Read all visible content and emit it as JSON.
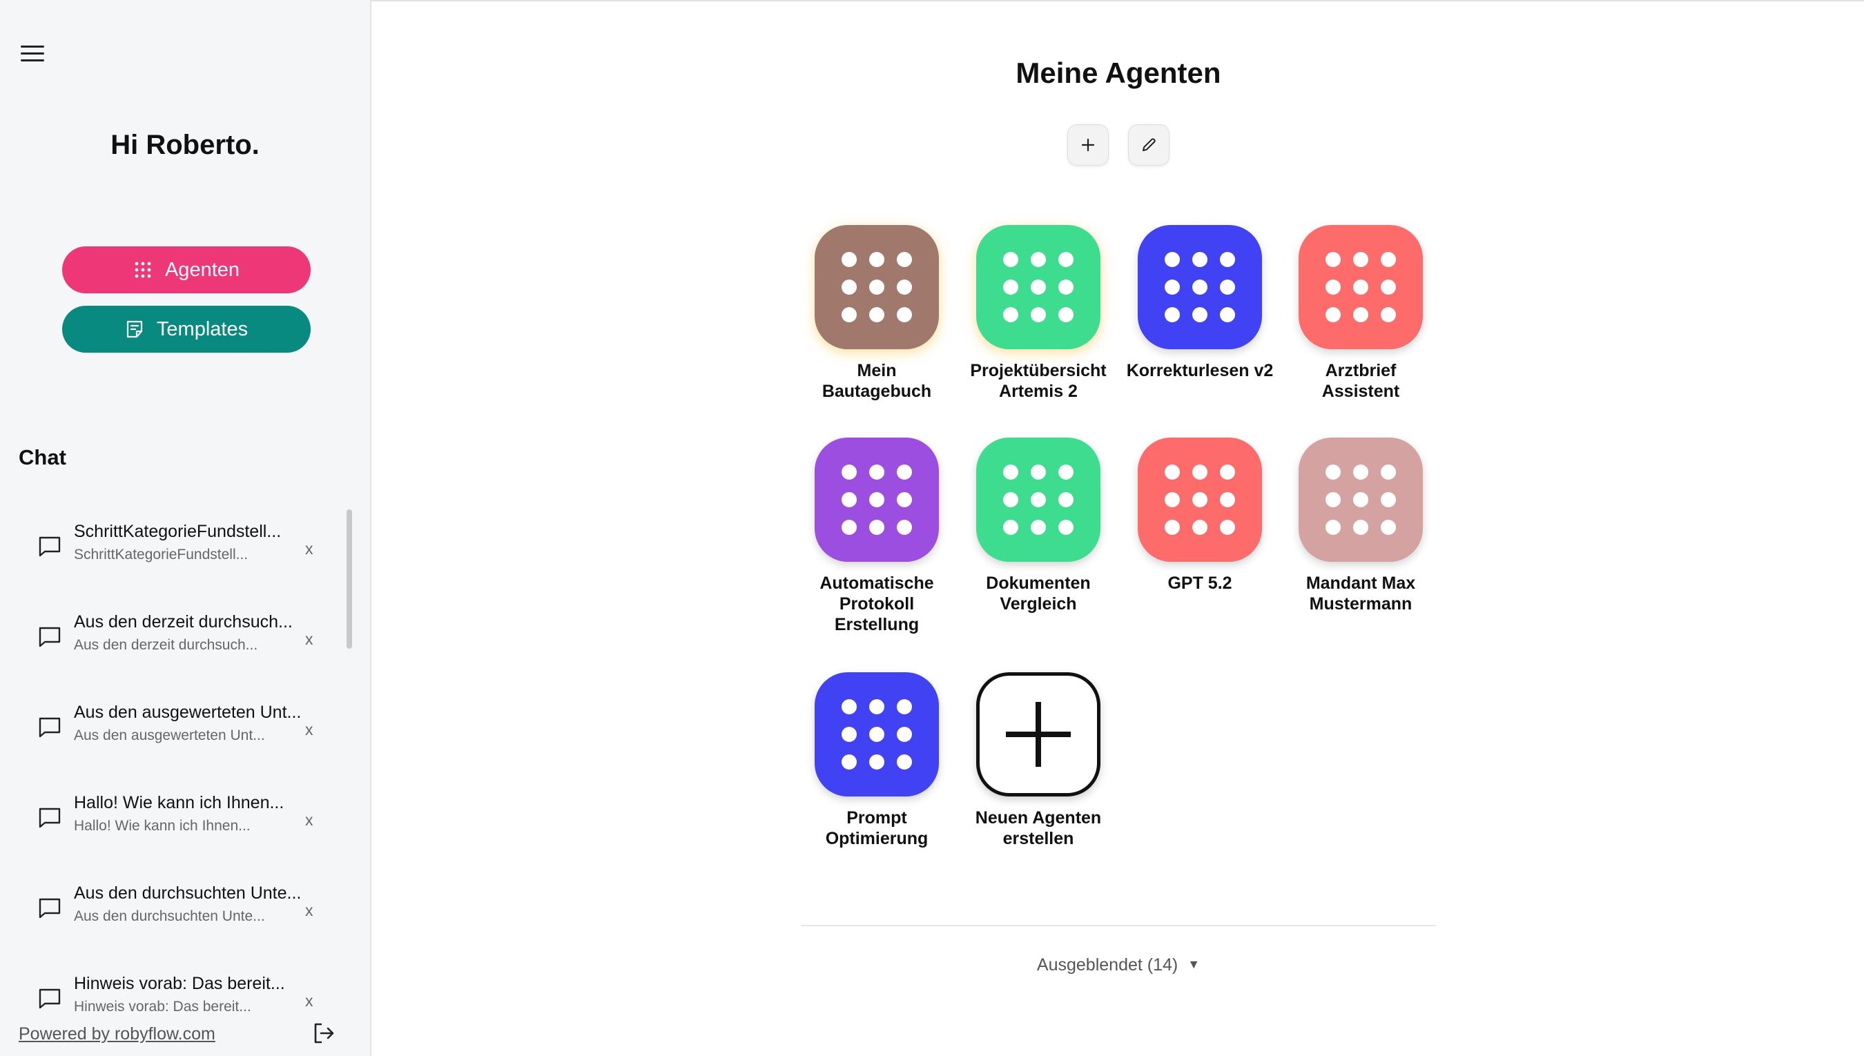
{
  "sidebar": {
    "greeting": "Hi Roberto.",
    "nav": [
      {
        "label": "Agenten",
        "color": "#ee3777"
      },
      {
        "label": "Templates",
        "color": "#098a80"
      }
    ],
    "chat_heading": "Chat",
    "chats": [
      {
        "title": "SchrittKategorieFundstell...",
        "subtitle": "SchrittKategorieFundstell..."
      },
      {
        "title": "Aus den derzeit durchsuch...",
        "subtitle": "Aus den derzeit durchsuch..."
      },
      {
        "title": "Aus den ausgewerteten Unt...",
        "subtitle": "Aus den ausgewerteten Unt..."
      },
      {
        "title": "Hallo! Wie kann ich Ihnen...",
        "subtitle": "Hallo! Wie kann ich Ihnen..."
      },
      {
        "title": "Aus den durchsuchten Unte...",
        "subtitle": "Aus den durchsuchten Unte..."
      },
      {
        "title": "Hinweis vorab: Das bereit...",
        "subtitle": "Hinweis vorab: Das bereit..."
      }
    ],
    "delete_label": "x",
    "powered_by": "Powered by robyflow.com"
  },
  "main": {
    "title": "Meine Agenten",
    "agents": [
      {
        "name": "Mein\nBautagebuch",
        "color": "#a0786c"
      },
      {
        "name": "Projektübersicht\nArtemis 2",
        "color": "#3ddc8e"
      },
      {
        "name": "Korrekturlesen v2",
        "color": "#4242f5"
      },
      {
        "name": "Arztbrief\nAssistent",
        "color": "#fd6b6b"
      },
      {
        "name": "Automatische\nProtokoll\nErstellung",
        "color": "#9b4ee0"
      },
      {
        "name": "Dokumenten\nVergleich",
        "color": "#3ddc8e"
      },
      {
        "name": "GPT 5.2",
        "color": "#fd6b6b"
      },
      {
        "name": "Mandant Max\nMustermann",
        "color": "#d4a3a1"
      },
      {
        "name": "Prompt\nOptimierung",
        "color": "#4242f5"
      }
    ],
    "new_agent_label": "Neuen Agenten\nerstellen",
    "hidden_label": "Ausgeblendet (14)",
    "hidden_caret": "▼"
  }
}
